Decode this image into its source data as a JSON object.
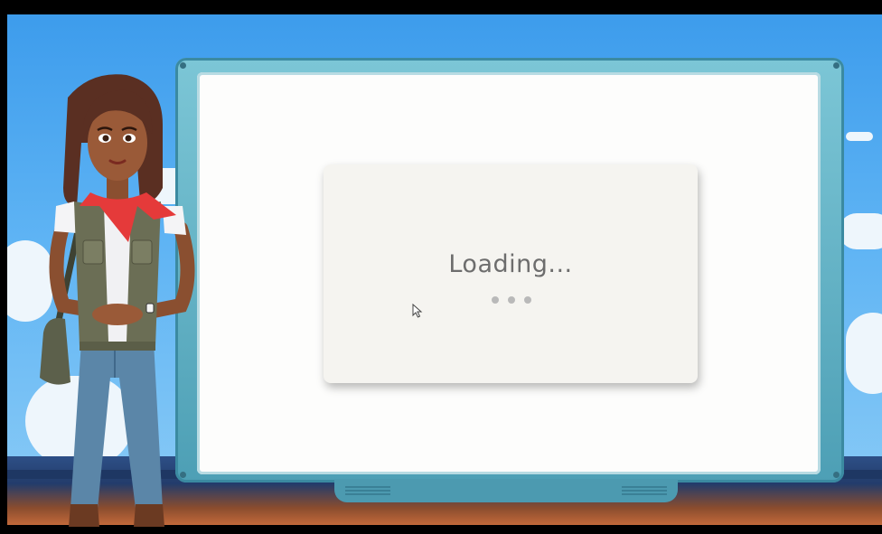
{
  "screen": {
    "loading_text": "Loading...",
    "loading_indicator_dots": 3
  },
  "colors": {
    "sky": "#4ea8ef",
    "board_frame": "#5fb0c4",
    "screen": "#fdfdfc",
    "card": "#f5f4f0",
    "text": "#6d6d6d",
    "dot": "#b9b9b9",
    "scarf": "#e53a3a",
    "vest": "#6b6e55",
    "jeans": "#5b86a8"
  }
}
